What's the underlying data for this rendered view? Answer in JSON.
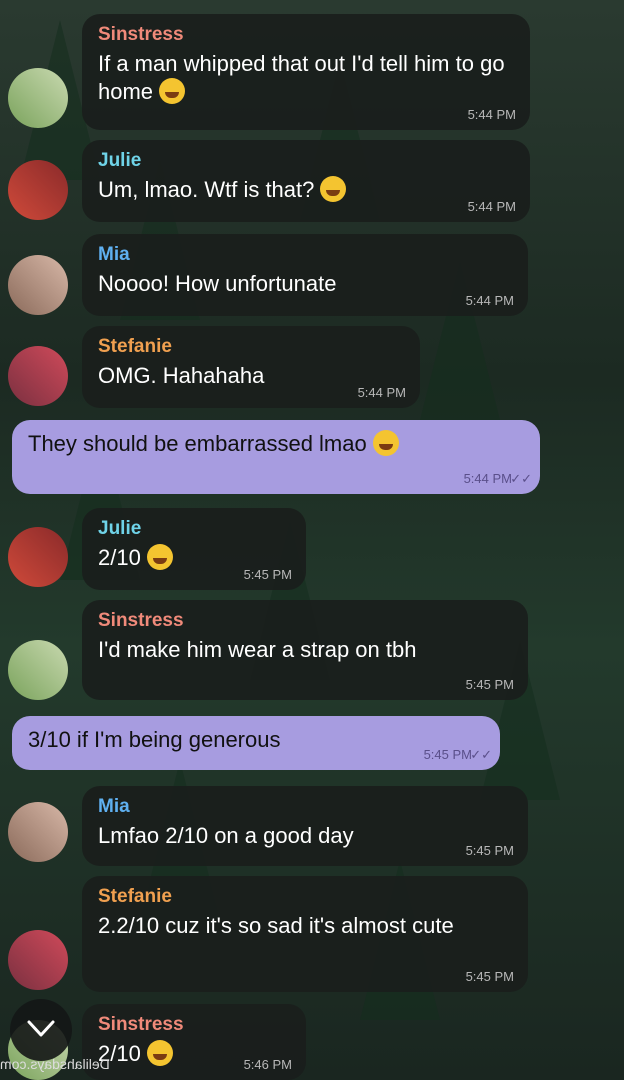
{
  "colors": {
    "incoming_bubble": "#1a1e1c",
    "outgoing_bubble": "#a79ce0",
    "name_sinstress": "#f08a7a",
    "name_julie": "#6fd3e8",
    "name_mia": "#5fb0f0",
    "name_stefanie": "#f0a050"
  },
  "watermark": "Delilahsdays.com",
  "scroll_button": {
    "icon": "chevron-down-icon"
  },
  "messages": [
    {
      "sender": "Sinstress",
      "text": "If a man whipped that out I'd tell him to go home",
      "emoji": "rolling-on-floor-laughing",
      "time": "5:44 PM"
    },
    {
      "sender": "Julie",
      "text": "Um, lmao. Wtf is that?",
      "emoji": "rolling-on-floor-laughing",
      "time": "5:44 PM"
    },
    {
      "sender": "Mia",
      "text": "Noooo! How unfortunate",
      "time": "5:44 PM"
    },
    {
      "sender": "Stefanie",
      "text": "OMG. Hahahaha",
      "time": "5:44 PM"
    },
    {
      "outgoing": true,
      "text": "They should be embarrassed lmao",
      "emoji": "face-with-tears-of-joy",
      "time": "5:44 PM"
    },
    {
      "sender": "Julie",
      "text": "2/10",
      "emoji": "grimacing-face",
      "time": "5:45 PM"
    },
    {
      "sender": "Sinstress",
      "text": "I'd make him wear a strap on tbh",
      "time": "5:45 PM"
    },
    {
      "outgoing": true,
      "text": "3/10 if I'm being generous",
      "time": "5:45 PM"
    },
    {
      "sender": "Mia",
      "text": "Lmfao 2/10 on a good day",
      "time": "5:45 PM"
    },
    {
      "sender": "Stefanie",
      "text": "2.2/10 cuz it's so sad it's almost cute",
      "time": "5:45 PM"
    },
    {
      "sender": "Sinstress",
      "text": "2/10",
      "emoji": "yawning-face",
      "time": "5:46 PM"
    }
  ]
}
